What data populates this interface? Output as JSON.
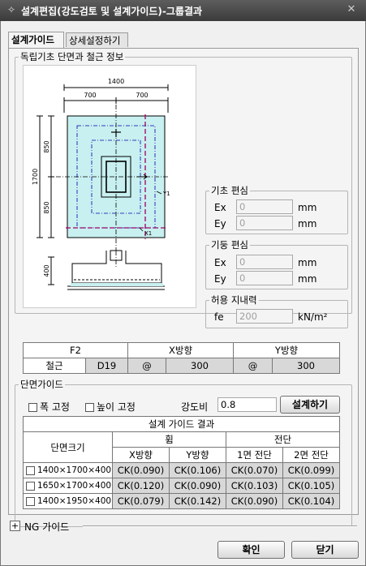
{
  "window": {
    "title": "설계편집(강도검토 및 설계가이드)-그룹결과"
  },
  "tabs": [
    {
      "label": "설계가이드"
    },
    {
      "label": "상세설정하기"
    }
  ],
  "section_info": {
    "legend": "독립기초 단면과 철근 정보"
  },
  "drawing": {
    "dim_total_x": "1400",
    "dim_half_x_left": "700",
    "dim_half_x_right": "700",
    "dim_total_y": "1700",
    "dim_half_y_top": "850",
    "dim_half_y_bottom": "850",
    "dim_height": "400",
    "label_y1": "Y1",
    "label_x1": "X1"
  },
  "foundation_ecc": {
    "legend": "기초 편심",
    "ex_label": "Ex",
    "ex_value": "0",
    "ex_unit": "mm",
    "ey_label": "Ey",
    "ey_value": "0",
    "ey_unit": "mm"
  },
  "column_ecc": {
    "legend": "기둥 편심",
    "ex_label": "Ex",
    "ex_value": "0",
    "ex_unit": "mm",
    "ey_label": "Ey",
    "ey_value": "0",
    "ey_unit": "mm"
  },
  "bearing": {
    "legend": "허용 지내력",
    "fe_label": "fe",
    "fe_value": "200",
    "unit": "kN/m²"
  },
  "rebar_table": {
    "name": "F2",
    "x_dir": "X방향",
    "y_dir": "Y방향",
    "rebar_label": "철근",
    "rebar_size": "D19",
    "x_at": "@",
    "x_spacing": "300",
    "y_at": "@",
    "y_spacing": "300"
  },
  "guide": {
    "legend": "단면가이드",
    "fix_width": "폭 고정",
    "fix_height": "높이 고정",
    "strength_ratio_label": "강도비",
    "strength_ratio_value": "0.8",
    "design_button": "설계하기"
  },
  "results": {
    "title": "설계 가이드 결과",
    "col_size": "단면크기",
    "bending": "휨",
    "shear": "전단",
    "x_dir": "X방향",
    "y_dir": "Y방향",
    "one_way": "1면 전단",
    "two_way": "2면 전단",
    "rows": [
      {
        "size": "1400×1700×400",
        "bx": "CK(0.090)",
        "by": "CK(0.106)",
        "s1": "CK(0.070)",
        "s2": "CK(0.099)"
      },
      {
        "size": "1650×1700×400",
        "bx": "CK(0.120)",
        "by": "CK(0.090)",
        "s1": "CK(0.103)",
        "s2": "CK(0.105)"
      },
      {
        "size": "1400×1950×400",
        "bx": "CK(0.079)",
        "by": "CK(0.142)",
        "s1": "CK(0.090)",
        "s2": "CK(0.104)"
      }
    ]
  },
  "ng_guide": {
    "label": "NG 가이드"
  },
  "buttons": {
    "ok": "확인",
    "close": "닫기"
  }
}
